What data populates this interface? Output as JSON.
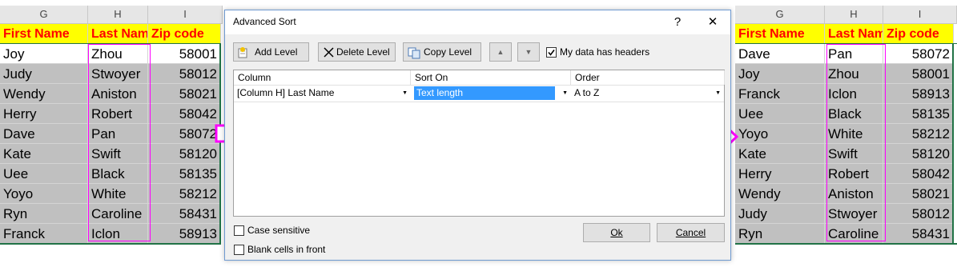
{
  "left_sheet": {
    "col_headers": [
      "G",
      "H",
      "I"
    ],
    "header_row": [
      "First Name",
      "Last Nam",
      "Zip code"
    ],
    "rows": [
      {
        "first": "Joy",
        "last": "Zhou",
        "zip": "58001"
      },
      {
        "first": "Judy",
        "last": "Stwoyer",
        "zip": "58012"
      },
      {
        "first": "Wendy",
        "last": "Aniston",
        "zip": "58021"
      },
      {
        "first": "Herry",
        "last": "Robert",
        "zip": "58042"
      },
      {
        "first": "Dave",
        "last": "Pan",
        "zip": "58072"
      },
      {
        "first": "Kate",
        "last": "Swift",
        "zip": "58120"
      },
      {
        "first": "Uee",
        "last": "Black",
        "zip": "58135"
      },
      {
        "first": "Yoyo",
        "last": "White",
        "zip": "58212"
      },
      {
        "first": "Ryn",
        "last": "Caroline",
        "zip": "58431"
      },
      {
        "first": "Franck",
        "last": "Iclon",
        "zip": "58913"
      }
    ]
  },
  "right_sheet": {
    "col_headers": [
      "G",
      "H",
      "I"
    ],
    "header_row": [
      "First Name",
      "Last Nam",
      "Zip code"
    ],
    "rows": [
      {
        "first": "Dave",
        "last": "Pan",
        "zip": "58072"
      },
      {
        "first": "Joy",
        "last": "Zhou",
        "zip": "58001"
      },
      {
        "first": "Franck",
        "last": "Iclon",
        "zip": "58913"
      },
      {
        "first": "Uee",
        "last": "Black",
        "zip": "58135"
      },
      {
        "first": "Yoyo",
        "last": "White",
        "zip": "58212"
      },
      {
        "first": "Kate",
        "last": "Swift",
        "zip": "58120"
      },
      {
        "first": "Herry",
        "last": "Robert",
        "zip": "58042"
      },
      {
        "first": "Wendy",
        "last": "Aniston",
        "zip": "58021"
      },
      {
        "first": "Judy",
        "last": "Stwoyer",
        "zip": "58012"
      },
      {
        "first": "Ryn",
        "last": "Caroline",
        "zip": "58431"
      }
    ]
  },
  "dialog": {
    "title": "Advanced Sort",
    "help": "?",
    "close": "✕",
    "add_level": "Add Level",
    "delete_level": "Delete Level",
    "copy_level": "Copy Level",
    "move_up": "▲",
    "move_down": "▼",
    "headers_checkbox": "My data has headers",
    "headers_checked": true,
    "grid_headers": {
      "column": "Column",
      "sort_on": "Sort On",
      "order": "Order"
    },
    "level": {
      "column": "[Column H] Last Name",
      "sort_on": "Text length",
      "order": "A to Z"
    },
    "case_sensitive": "Case sensitive",
    "blank_cells": "Blank cells in front",
    "ok": "Ok",
    "cancel": "Cancel"
  },
  "colors": {
    "header_fill": "#ffff00",
    "header_text": "#ff0000",
    "selection_border": "#ff00ff",
    "arrow": "#ff00ff",
    "sheet_border": "#217346",
    "highlight": "#3399ff"
  }
}
